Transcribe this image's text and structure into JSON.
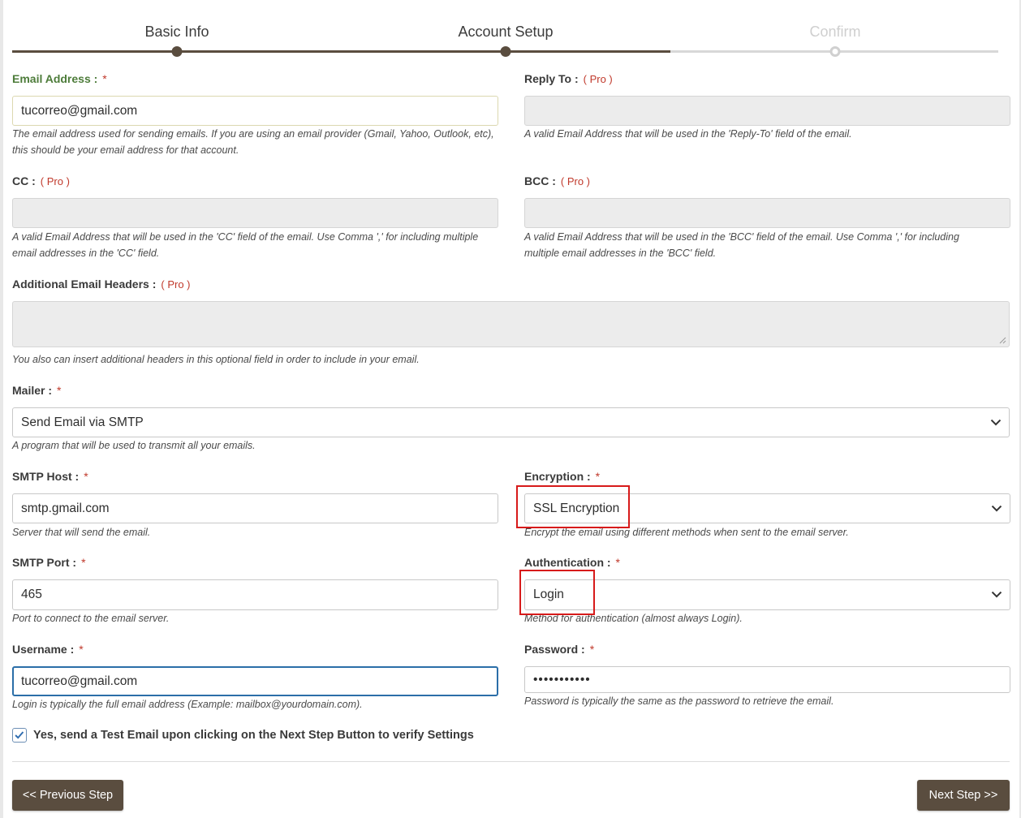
{
  "stepper": {
    "steps": [
      {
        "label": "Basic Info",
        "state": "done"
      },
      {
        "label": "Account Setup",
        "state": "current"
      },
      {
        "label": "Confirm",
        "state": "pending"
      }
    ]
  },
  "required_mark": "*",
  "pro_badge": "( Pro )",
  "fields": {
    "email_address": {
      "label": "Email Address :",
      "value": "tucorreo@gmail.com",
      "help": "The email address used for sending emails. If you are using an email provider (Gmail, Yahoo, Outlook, etc), this should be your email address for that account."
    },
    "reply_to": {
      "label": "Reply To :",
      "value": "",
      "help": "A valid Email Address that will be used in the 'Reply-To' field of the email."
    },
    "cc": {
      "label": "CC :",
      "value": "",
      "help": "A valid Email Address that will be used in the 'CC' field of the email. Use Comma ',' for including multiple email addresses in the 'CC' field."
    },
    "bcc": {
      "label": "BCC :",
      "value": "",
      "help": "A valid Email Address that will be used in the 'BCC' field of the email. Use Comma ',' for including multiple email addresses in the 'BCC' field."
    },
    "additional_headers": {
      "label": "Additional Email Headers :",
      "value": "",
      "help": "You also can insert additional headers in this optional field in order to include in your email."
    },
    "mailer": {
      "label": "Mailer :",
      "value": "Send Email via SMTP",
      "help": "A program that will be used to transmit all your emails."
    },
    "smtp_host": {
      "label": "SMTP Host :",
      "value": "smtp.gmail.com",
      "help": "Server that will send the email."
    },
    "encryption": {
      "label": "Encryption :",
      "value": "SSL Encryption",
      "help": "Encrypt the email using different methods when sent to the email server."
    },
    "smtp_port": {
      "label": "SMTP Port :",
      "value": "465",
      "help": "Port to connect to the email server."
    },
    "authentication": {
      "label": "Authentication :",
      "value": "Login",
      "help": "Method for authentication (almost always Login)."
    },
    "username": {
      "label": "Username :",
      "value": "tucorreo@gmail.com",
      "help": "Login is typically the full email address (Example: mailbox@yourdomain.com)."
    },
    "password": {
      "label": "Password :",
      "value": "•••••••••••",
      "help": "Password is typically the same as the password to retrieve the email."
    }
  },
  "test_email": {
    "checked": true,
    "label": "Yes, send a Test Email upon clicking on the Next Step Button to verify Settings"
  },
  "buttons": {
    "previous": "<< Previous Step",
    "next": "Next Step >>"
  },
  "colors": {
    "accent": "#5a4d3f",
    "required": "#c0392b",
    "highlight": "#d71a1a",
    "focus": "#2b6ea8"
  }
}
